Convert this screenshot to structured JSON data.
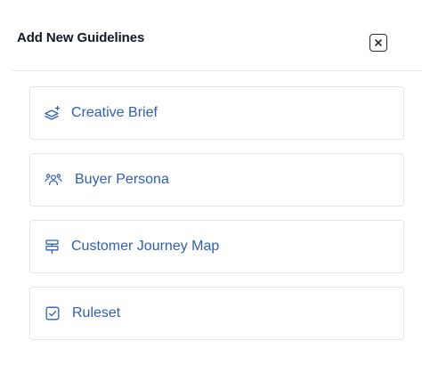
{
  "dialog": {
    "title": "Add New Guidelines",
    "close_icon": "close-icon"
  },
  "guidelines": [
    {
      "label": "Creative Brief",
      "icon": "layers-sparkle-icon"
    },
    {
      "label": "Buyer Persona",
      "icon": "users-icon"
    },
    {
      "label": "Customer Journey Map",
      "icon": "signpost-icon"
    },
    {
      "label": "Ruleset",
      "icon": "checkbox-icon"
    }
  ],
  "colors": {
    "accent": "#2f5fb3",
    "border": "#e3e5e8",
    "title": "#111827"
  }
}
